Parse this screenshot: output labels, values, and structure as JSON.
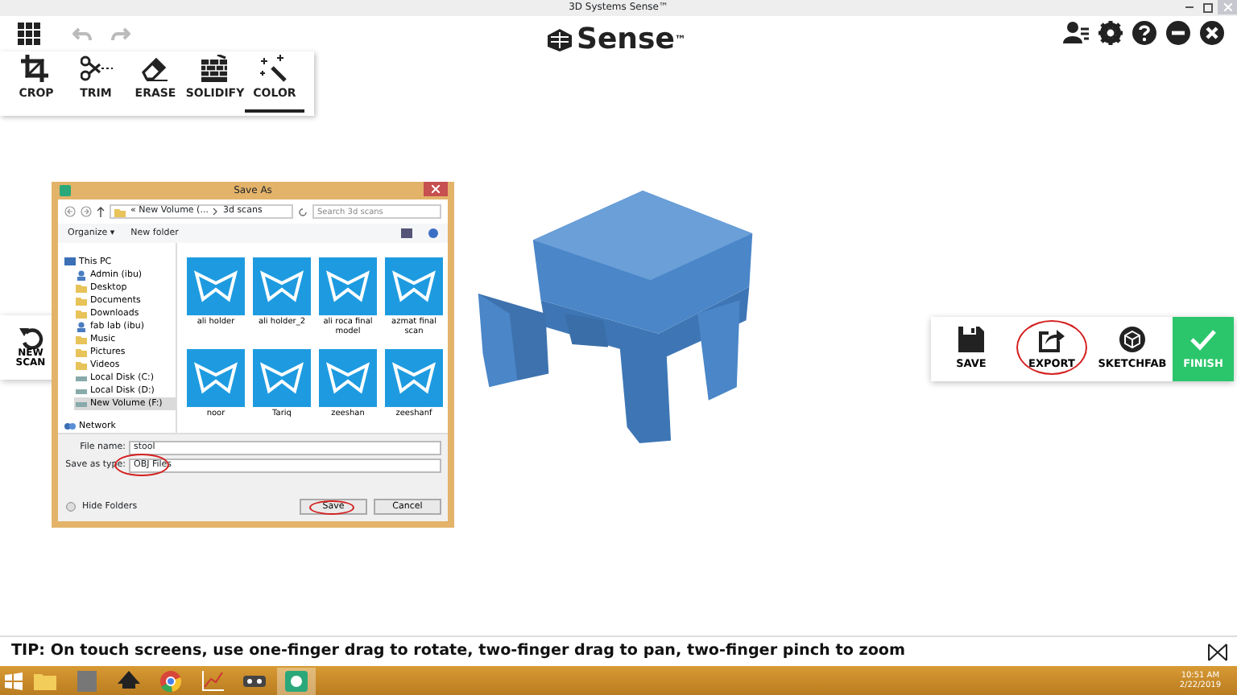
{
  "window": {
    "title": "3D Systems Sense™"
  },
  "header": {
    "logo": "Sense$^{™}$"
  },
  "tools": [
    {
      "label": "CROP",
      "kind": "crop",
      "selected": false
    },
    {
      "label": "TRIM",
      "kind": "trim",
      "selected": false
    },
    {
      "label": "ERASE",
      "kind": "erase",
      "selected": false
    },
    {
      "label": "SOLIDIFY",
      "kind": "solidify",
      "selected": false
    },
    {
      "label": "COLOR",
      "kind": "color",
      "selected": true
    }
  ],
  "side_button": {
    "label": "NEW SCAN"
  },
  "dialog": {
    "title": "Save As",
    "path": [
      "« New Volume (...",
      "3d scans"
    ],
    "search": {
      "placeholder": "Search 3d scans"
    },
    "toolbar": [
      "Organize ▾",
      "New folder"
    ],
    "nav": [
      {
        "label": "This PC",
        "kind": "pc",
        "selected": false,
        "children": [
          {
            "label": "Admin (ibu)",
            "kind": "user",
            "selected": false
          },
          {
            "label": "Desktop",
            "kind": "folder",
            "selected": false
          },
          {
            "label": "Documents",
            "kind": "folder",
            "selected": false
          },
          {
            "label": "Downloads",
            "kind": "folder",
            "selected": false
          },
          {
            "label": "fab lab (ibu)",
            "kind": "user",
            "selected": false
          },
          {
            "label": "Music",
            "kind": "folder",
            "selected": false
          },
          {
            "label": "Pictures",
            "kind": "folder",
            "selected": false
          },
          {
            "label": "Videos",
            "kind": "folder",
            "selected": false
          },
          {
            "label": "Local Disk (C:)",
            "kind": "drive",
            "selected": false
          },
          {
            "label": "Local Disk (D:)",
            "kind": "drive",
            "selected": false
          },
          {
            "label": "New Volume (F:)",
            "kind": "drive",
            "selected": true
          }
        ]
      },
      {
        "label": "Network",
        "kind": "network",
        "selected": false
      }
    ],
    "files": [
      "ali holder",
      "ali holder_2",
      "ali roca final model",
      "azmat final scan",
      "noor",
      "Tariq",
      "zeeshan",
      "zeeshanf"
    ],
    "fields": [
      {
        "label": "File name:",
        "value": "stool",
        "circled": false
      },
      {
        "label": "Save as type:",
        "value": "OBJ Files",
        "circled": true
      }
    ],
    "hide_folders": "Hide Folders",
    "buttons": [
      {
        "label": "Save",
        "circled": true
      },
      {
        "label": "Cancel",
        "circled": false
      }
    ]
  },
  "actions": [
    {
      "label": "SAVE",
      "kind": "save",
      "circled": false
    },
    {
      "label": "EXPORT",
      "kind": "export",
      "circled": true
    },
    {
      "label": "SKETCHFAB",
      "kind": "sketchfab",
      "circled": false
    },
    {
      "label": "FINISH",
      "kind": "finish",
      "circled": false
    }
  ],
  "tip": {
    "text": "TIP: On touch screens, use one-finger drag to rotate, two-finger drag to pan, two-finger pinch to zoom"
  },
  "taskbar": {
    "apps": [
      {
        "kind": "explorer"
      },
      {
        "kind": "viewer"
      },
      {
        "kind": "inkscape"
      },
      {
        "kind": "chrome"
      },
      {
        "kind": "chart"
      },
      {
        "kind": "controller"
      },
      {
        "kind": "sense",
        "selected": true
      }
    ],
    "clock": "10:51 AM",
    "date": "2/22/2019"
  }
}
